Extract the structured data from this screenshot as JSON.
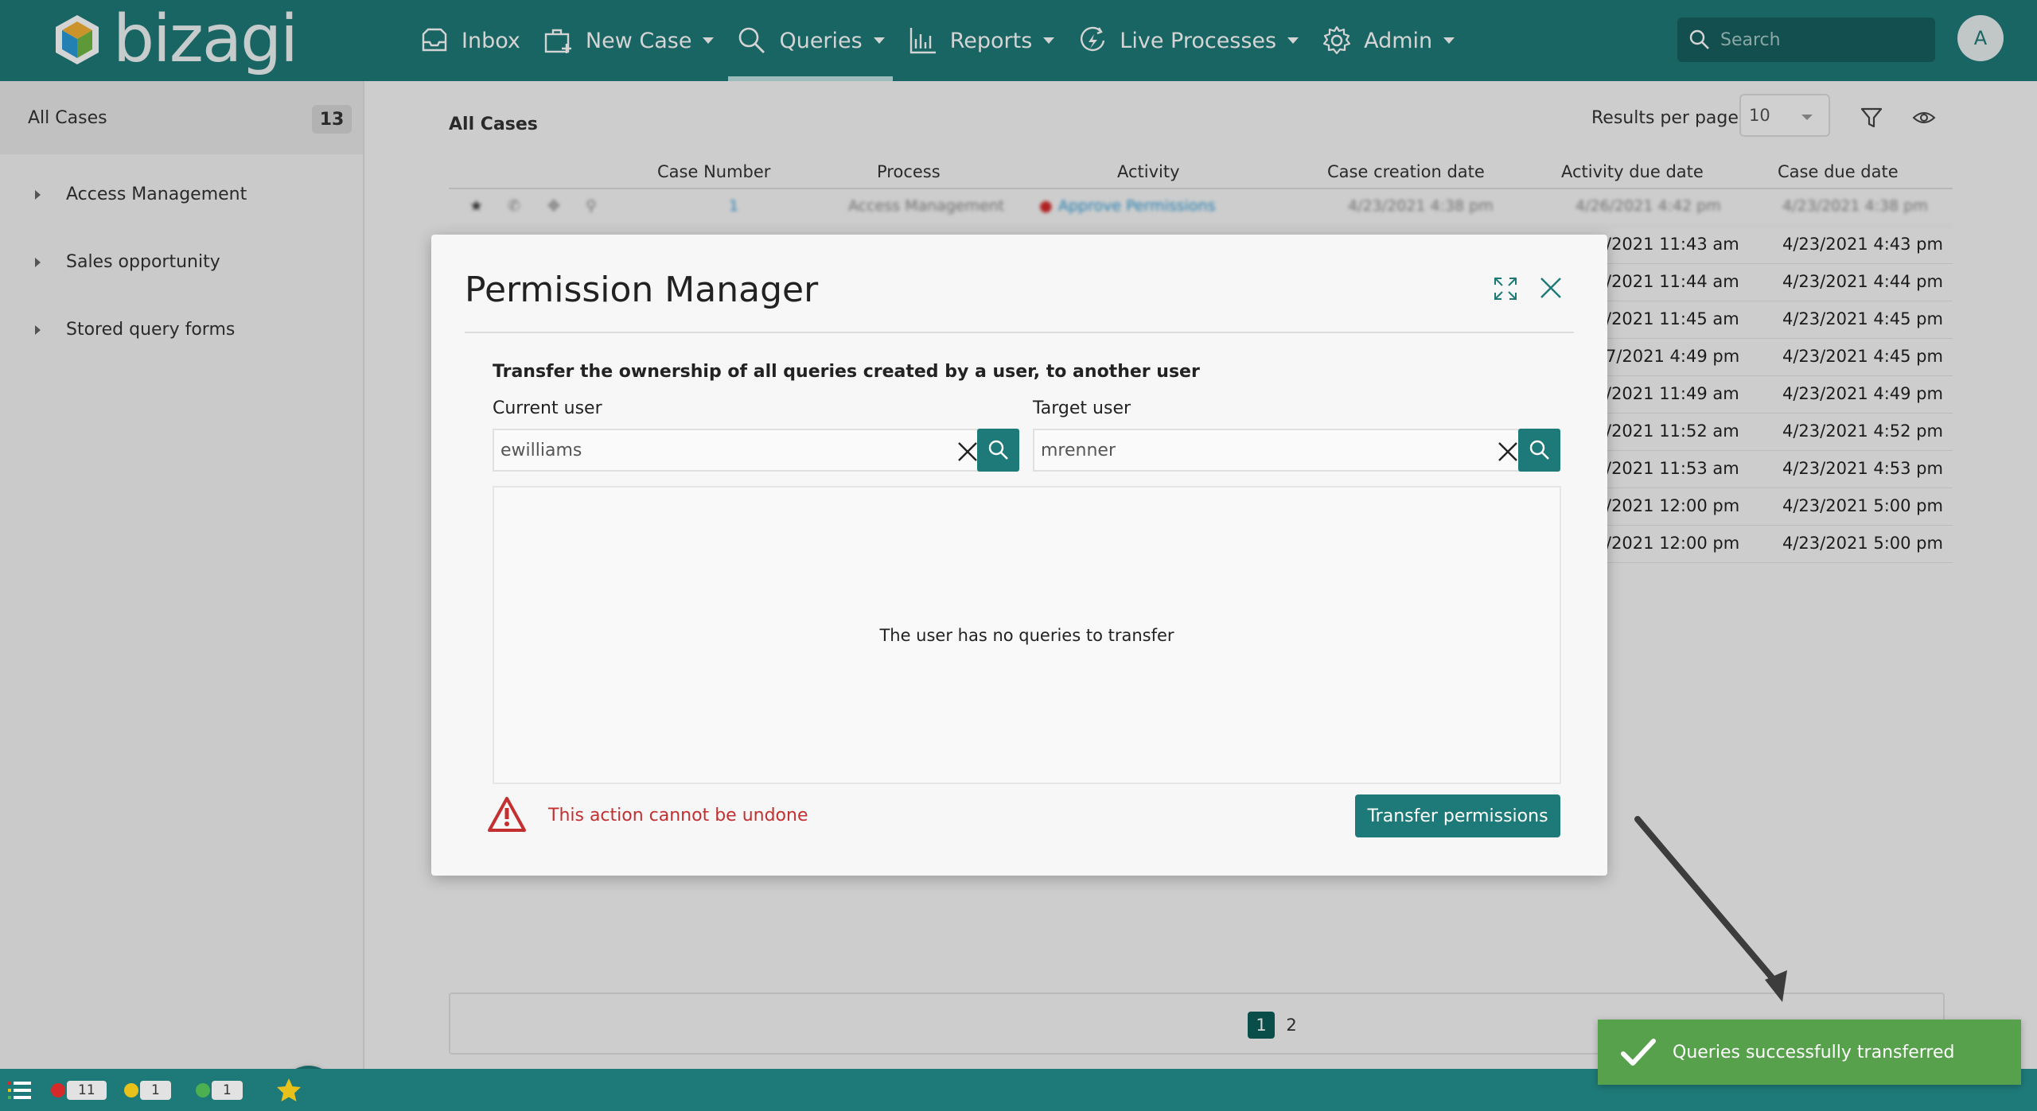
{
  "header": {
    "logo_text": "bizagi",
    "nav": [
      {
        "label": "Inbox",
        "icon": "inbox-icon",
        "dropdown": false
      },
      {
        "label": "New Case",
        "icon": "new-case-icon",
        "dropdown": true
      },
      {
        "label": "Queries",
        "icon": "search-icon",
        "dropdown": true,
        "active": true
      },
      {
        "label": "Reports",
        "icon": "reports-icon",
        "dropdown": true
      },
      {
        "label": "Live Processes",
        "icon": "live-processes-icon",
        "dropdown": true
      },
      {
        "label": "Admin",
        "icon": "gear-icon",
        "dropdown": true
      }
    ],
    "search_placeholder": "Search",
    "avatar_initial": "A"
  },
  "sidebar": {
    "title": "All Cases",
    "count": "13",
    "items": [
      "Access Management",
      "Sales opportunity",
      "Stored query forms"
    ]
  },
  "main": {
    "title": "All Cases",
    "results_per_page_label": "Results per page",
    "results_per_page_value": "10",
    "columns": [
      "Case Number",
      "Process",
      "Activity",
      "Case creation date",
      "Activity due date",
      "Case due date"
    ],
    "first_row": {
      "case_number": "1",
      "process": "Access Management",
      "activity": "Approve Permissions",
      "creation": "4/23/2021 4:38 pm",
      "activity_due": "4/26/2021 4:42 pm",
      "case_due": "4/23/2021 4:38 pm"
    },
    "rows": [
      {
        "activity_due": "/2021 11:43 am",
        "case_due": "4/23/2021 4:43 pm"
      },
      {
        "activity_due": "/2021 11:44 am",
        "case_due": "4/23/2021 4:44 pm"
      },
      {
        "activity_due": "/2021 11:45 am",
        "case_due": "4/23/2021 4:45 pm"
      },
      {
        "activity_due": "7/2021 4:49 pm",
        "case_due": "4/23/2021 4:45 pm"
      },
      {
        "activity_due": "/2021 11:49 am",
        "case_due": "4/23/2021 4:49 pm"
      },
      {
        "activity_due": "/2021 11:52 am",
        "case_due": "4/23/2021 4:52 pm"
      },
      {
        "activity_due": "/2021 11:53 am",
        "case_due": "4/23/2021 4:53 pm"
      },
      {
        "activity_due": "/2021 12:00 pm",
        "case_due": "4/23/2021 5:00 pm"
      },
      {
        "activity_due": "/2021 12:00 pm",
        "case_due": "4/23/2021 5:00 pm"
      }
    ],
    "pages": [
      "1",
      "2"
    ],
    "current_page": "1"
  },
  "footer": {
    "red_count": "11",
    "yellow_count": "1",
    "green_count": "1",
    "colors": {
      "red": "#d42a2a",
      "yellow": "#e8c21a",
      "green": "#4caf50",
      "star": "#e8c21a"
    }
  },
  "modal": {
    "title": "Permission Manager",
    "description": "Transfer the ownership of all queries created by a user, to another user",
    "current_user_label": "Current user",
    "current_user_value": "ewilliams",
    "target_user_label": "Target user",
    "target_user_value": "mrenner",
    "empty_message": "The user has no queries to transfer",
    "warning": "This action cannot be undone",
    "transfer_button": "Transfer permissions"
  },
  "toast": {
    "message": "Queries successfully transferred"
  },
  "colors": {
    "brand": "#1e7a78",
    "warning": "#c43030",
    "success": "#58a14c"
  }
}
